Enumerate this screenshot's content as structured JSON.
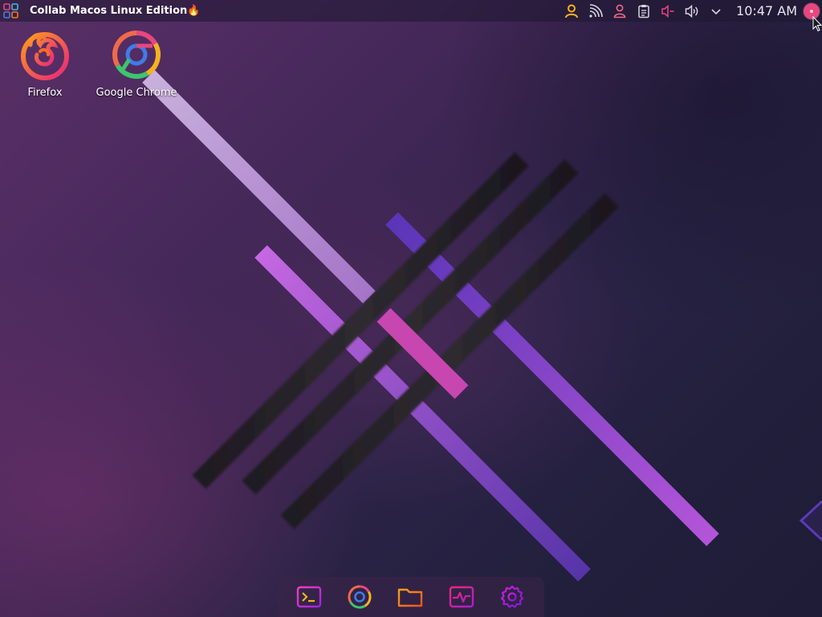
{
  "topbar": {
    "launcher_icon": "app-grid-icon",
    "title": "Collab Macos Linux Edition🔥",
    "tray": [
      {
        "name": "user-yellow-icon",
        "color": "#f5b21e"
      },
      {
        "name": "rss-feed-icon",
        "color": "#d9d4e2"
      },
      {
        "name": "user-account-icon",
        "color": "#f06a8a"
      },
      {
        "name": "clipboard-icon",
        "color": "#d9d4e2"
      },
      {
        "name": "microphone-muted-icon",
        "color": "#e8467e"
      },
      {
        "name": "volume-icon",
        "color": "#d9d4e2"
      },
      {
        "name": "chevron-down-icon",
        "color": "#d9d4e2"
      }
    ],
    "clock": "10:47 AM",
    "user_avatar_color": "#e8467e"
  },
  "desktop": {
    "icons": [
      {
        "label": "Firefox",
        "icon": "firefox-icon"
      },
      {
        "label": "Google Chrome",
        "icon": "chrome-icon"
      }
    ]
  },
  "dock": {
    "items": [
      {
        "name": "terminal-icon",
        "color": "#e040d0"
      },
      {
        "name": "chrome-icon",
        "color": "#e86a2a"
      },
      {
        "name": "folder-icon",
        "color": "#f07a1a"
      },
      {
        "name": "system-monitor-icon",
        "color": "#e8267e"
      },
      {
        "name": "settings-gear-icon",
        "color": "#c026d3"
      }
    ]
  },
  "colors": {
    "accent_pink": "#e8467e",
    "accent_purple": "#a64fd6",
    "panel_bg": "#1e1830"
  }
}
